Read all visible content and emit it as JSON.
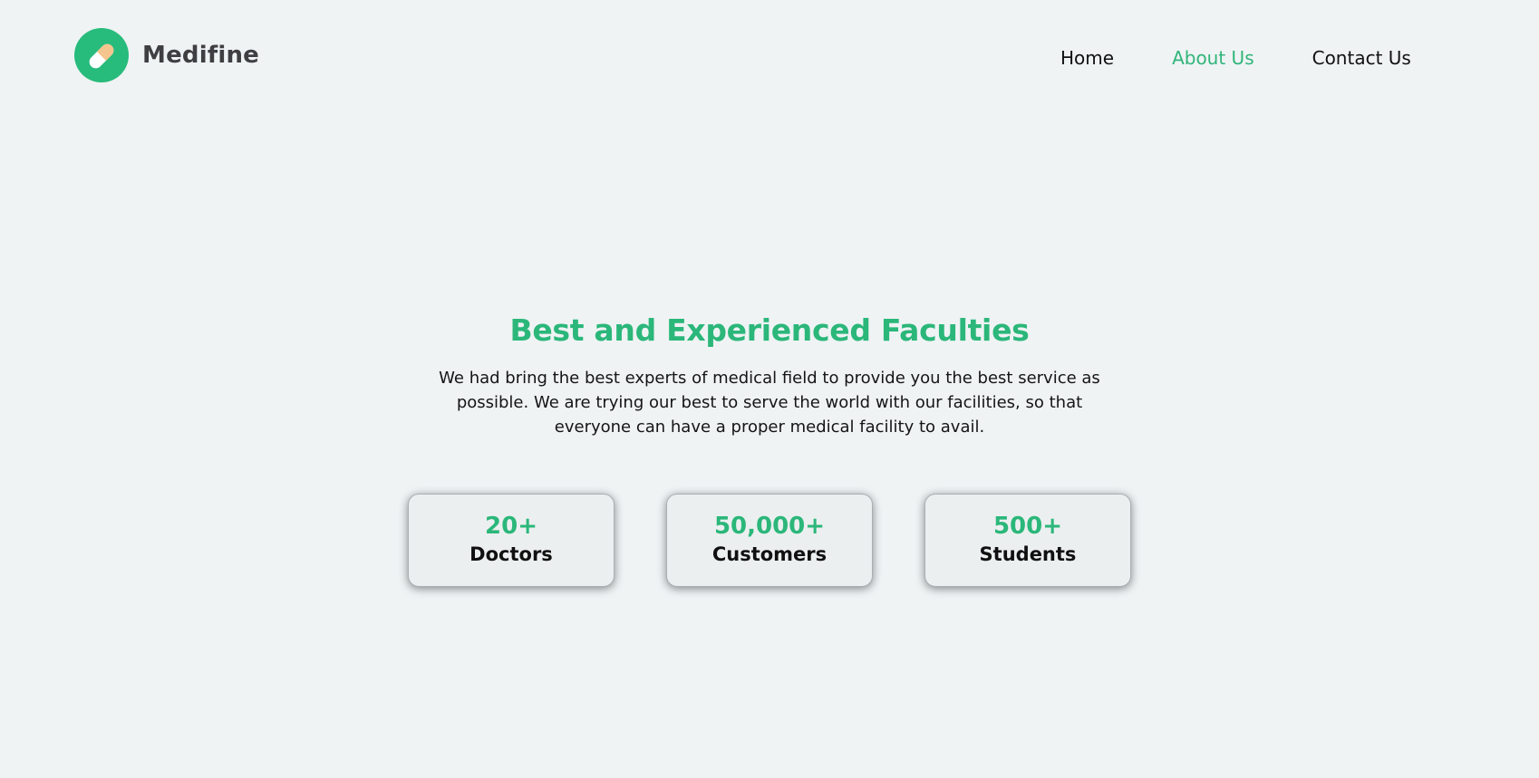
{
  "header": {
    "brand_name": "Medifine",
    "logo_icon": "pill-icon",
    "nav": [
      {
        "label": "Home",
        "active": false
      },
      {
        "label": "About Us",
        "active": true
      },
      {
        "label": "Contact Us",
        "active": false
      }
    ]
  },
  "hero": {
    "title": "Best and Experienced Faculties",
    "text": "We had bring the best experts of medical field to provide you the best service as possible. We are trying our best to serve the world with our facilities, so that everyone can have a proper medical facility to avail."
  },
  "stats": [
    {
      "value": "20+",
      "label": "Doctors"
    },
    {
      "value": "50,000+",
      "label": "Customers"
    },
    {
      "value": "500+",
      "label": "Students"
    }
  ],
  "colors": {
    "background": "#eff3f4",
    "accent": "#2bb77a",
    "text": "#111111"
  }
}
